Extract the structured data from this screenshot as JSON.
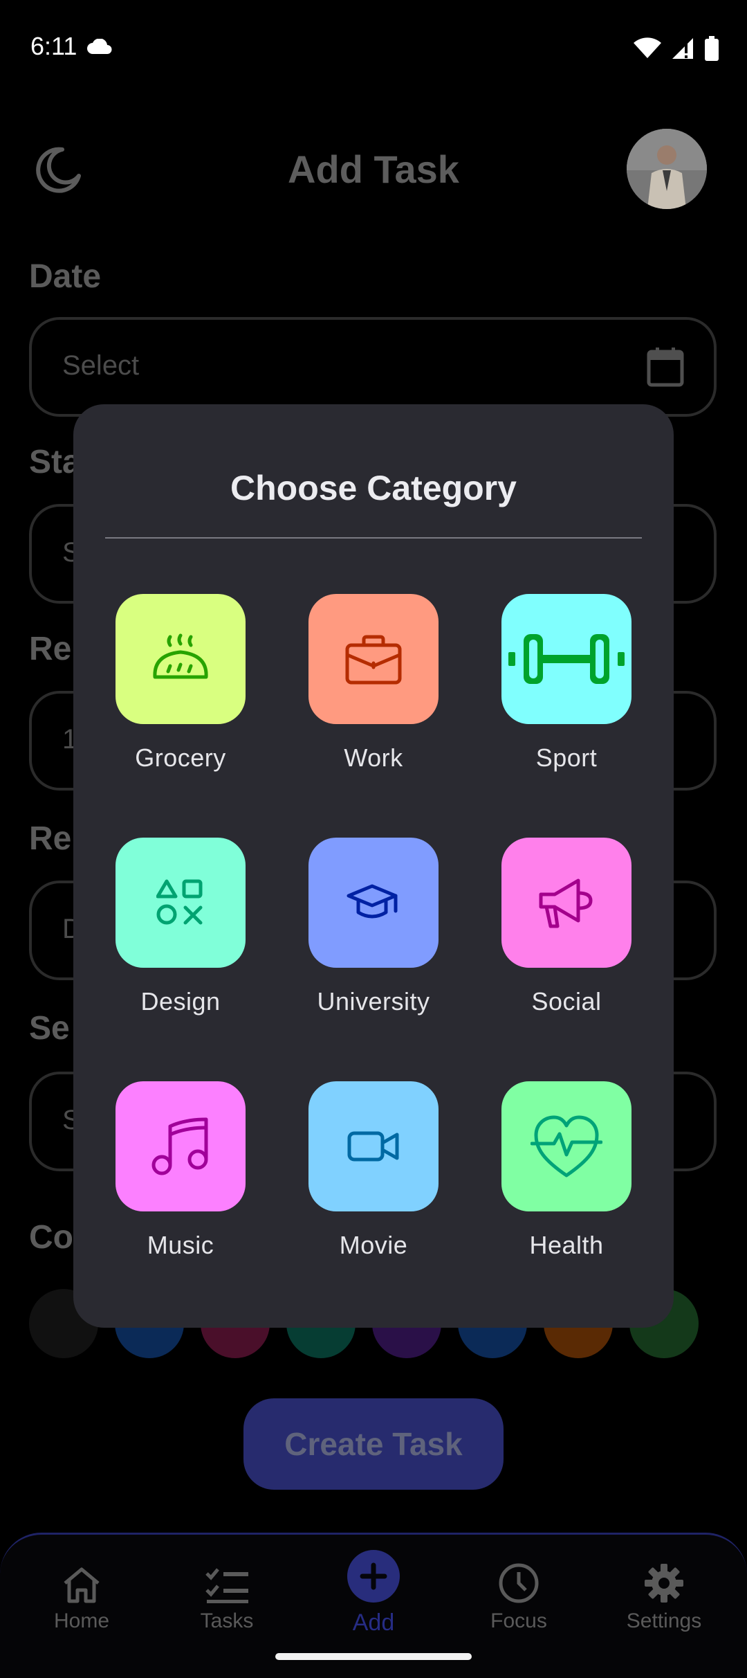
{
  "status_bar": {
    "time": "6:11"
  },
  "header": {
    "title": "Add Task"
  },
  "form": {
    "date_label": "Date",
    "date_placeholder": "Select",
    "start_label": "Sta",
    "start_value": "S",
    "reminder_label": "Re",
    "reminder_value": "1",
    "repeat_label": "Re",
    "repeat_value": "D",
    "section_label": "Se",
    "section_value": "S",
    "color_label": "Co"
  },
  "color_options": [
    "#111111",
    "#0b2a57",
    "#4a0f2a",
    "#063d33",
    "#2a1048",
    "#0b2a57",
    "#5a2a04",
    "#14391a"
  ],
  "create_button": "Create Task",
  "bottom_nav": [
    {
      "label": "Home",
      "icon": "home-icon"
    },
    {
      "label": "Tasks",
      "icon": "tasks-icon"
    },
    {
      "label": "Add",
      "icon": "plus-icon",
      "active": true
    },
    {
      "label": "Focus",
      "icon": "clock-icon"
    },
    {
      "label": "Settings",
      "icon": "gear-icon"
    }
  ],
  "dialog": {
    "title": "Choose Category",
    "categories": [
      {
        "label": "Grocery",
        "icon": "bread-icon",
        "bg": "#d9ff80",
        "fg": "#27a300"
      },
      {
        "label": "Work",
        "icon": "briefcase-icon",
        "bg": "#ff9a80",
        "fg": "#b52c00"
      },
      {
        "label": "Sport",
        "icon": "dumbbell-icon",
        "bg": "#80fffe",
        "fg": "#00a32c"
      },
      {
        "label": "Design",
        "icon": "shapes-icon",
        "bg": "#80ffd9",
        "fg": "#00a371"
      },
      {
        "label": "University",
        "icon": "graduation-cap-icon",
        "bg": "#809cff",
        "fg": "#0021a3"
      },
      {
        "label": "Social",
        "icon": "megaphone-icon",
        "bg": "#ff80eb",
        "fg": "#a3008c"
      },
      {
        "label": "Music",
        "icon": "music-icon",
        "bg": "#fc80ff",
        "fg": "#a00099"
      },
      {
        "label": "Movie",
        "icon": "video-icon",
        "bg": "#80d1ff",
        "fg": "#0069a3"
      },
      {
        "label": "Health",
        "icon": "heart-pulse-icon",
        "bg": "#80ffa3",
        "fg": "#00a378"
      }
    ]
  }
}
